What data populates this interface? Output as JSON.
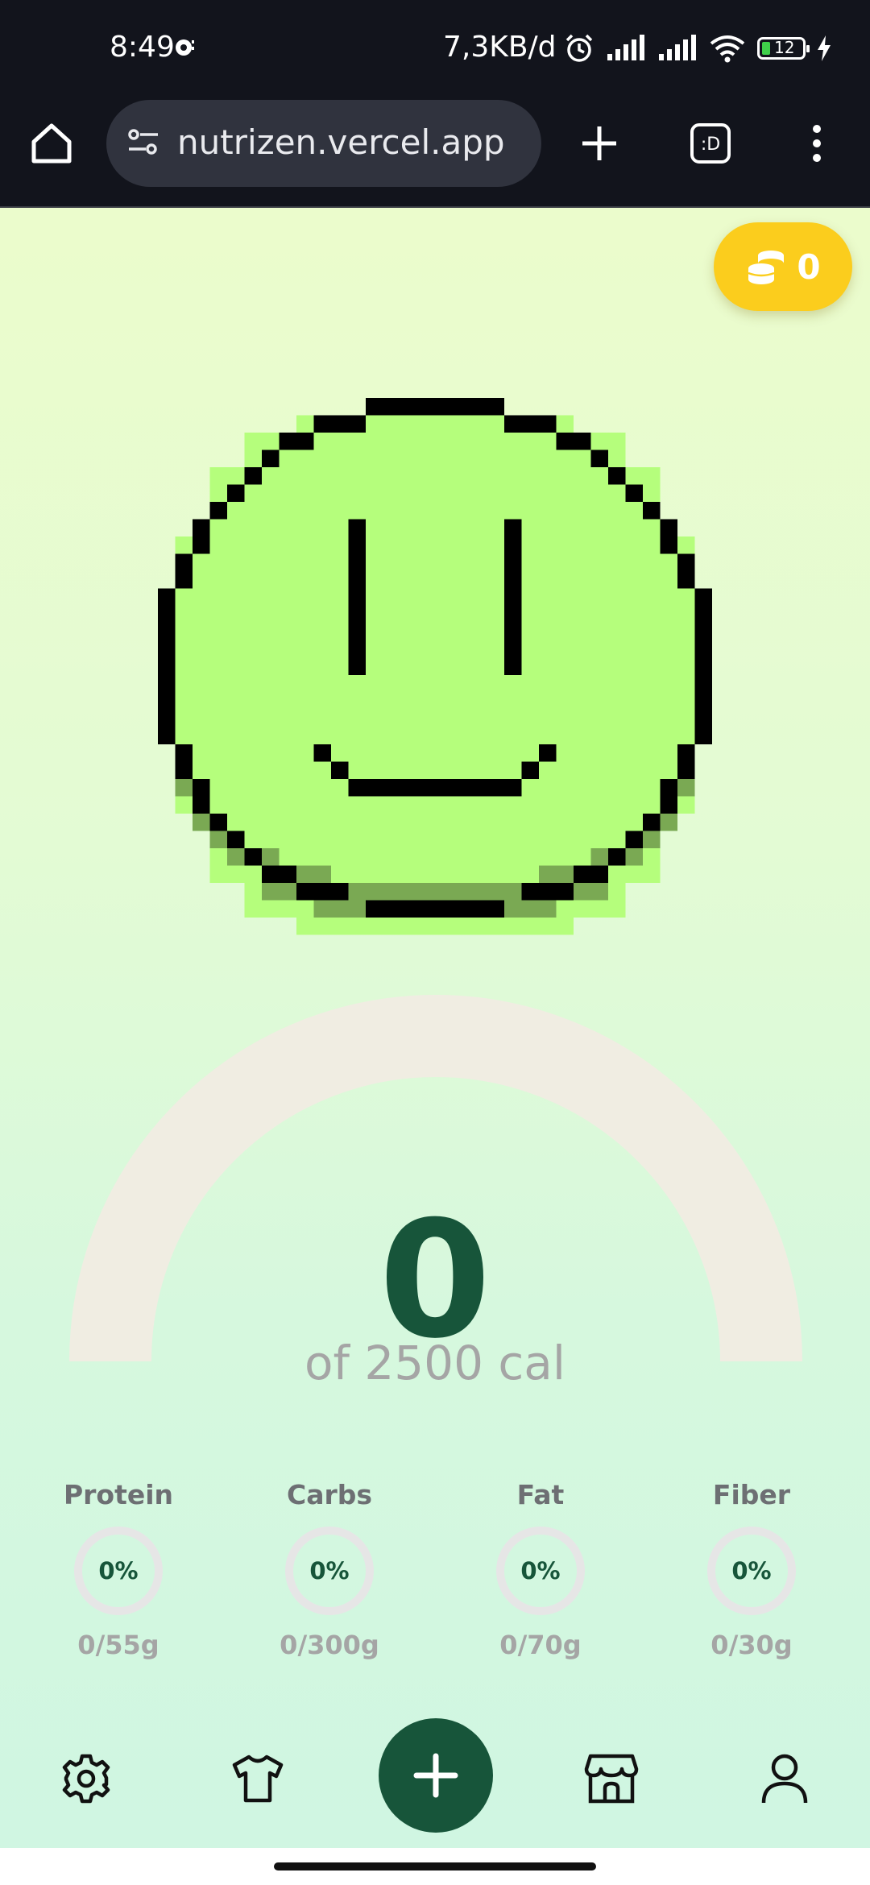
{
  "status_bar": {
    "time": "8:49",
    "network_speed": "7,3KB/d",
    "battery": "12"
  },
  "browser": {
    "url": "nutrizen.vercel.app",
    "tab_switcher_label": ":D"
  },
  "coins": {
    "count": "0"
  },
  "calories": {
    "consumed": "0",
    "goal_text": "of 2500 cal",
    "progress": 0
  },
  "macros": [
    {
      "name": "Protein",
      "percent": "0%",
      "amount": "0/55g"
    },
    {
      "name": "Carbs",
      "percent": "0%",
      "amount": "0/300g"
    },
    {
      "name": "Fat",
      "percent": "0%",
      "amount": "0/70g"
    },
    {
      "name": "Fiber",
      "percent": "0%",
      "amount": "0/30g"
    }
  ],
  "nav": {
    "items": [
      "gear-icon",
      "shirt-icon",
      "plus-icon",
      "shop-icon",
      "user-icon"
    ]
  },
  "colors": {
    "accent": "#17553a",
    "coin": "#fbcd1d",
    "face": "#b5fe7c",
    "face_shadow": "#7aa953"
  }
}
